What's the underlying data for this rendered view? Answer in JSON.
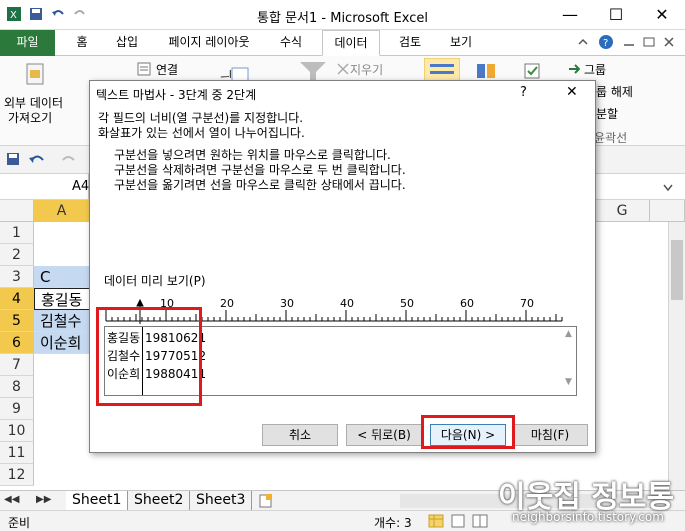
{
  "window": {
    "title": "통합 문서1 - Microsoft Excel",
    "min": "—",
    "max": "☐",
    "close": "✕"
  },
  "tabs": {
    "file": "파일",
    "items": [
      "홈",
      "삽입",
      "페이지 레이아웃",
      "수식",
      "데이터",
      "검토",
      "보기"
    ],
    "active": "데이터"
  },
  "ribbon": {
    "get_external_line1": "외부 데이터",
    "get_external_line2": "가져오기",
    "connections": "연결",
    "clear": "지우기",
    "group": "그룹",
    "ungroup": "룹 해제",
    "subtotal": "분할",
    "outline": "윤곽선"
  },
  "namebox": {
    "value": "A4"
  },
  "grid": {
    "col_letter_a": "A",
    "col_letter_g": "G",
    "rows": [
      "1",
      "2",
      "3",
      "4",
      "5",
      "6",
      "7",
      "8",
      "9",
      "10",
      "11",
      "12"
    ],
    "selected_rows": [
      "4",
      "5",
      "6"
    ],
    "row3_partial": "C",
    "names": [
      "홍길동",
      "김철수",
      "이순희"
    ]
  },
  "sheets": {
    "tabs": [
      "Sheet1",
      "Sheet2",
      "Sheet3"
    ],
    "active": "Sheet1"
  },
  "status": {
    "ready": "준비",
    "count": "개수: 3"
  },
  "dialog": {
    "title": "텍스트 마법사 - 3단계 중 2단계",
    "help": "?",
    "close": "✕",
    "line1": "각 필드의 너비(열 구분선)를 지정합니다.",
    "line2": "화살표가 있는 선에서 열이 나누어집니다.",
    "instr1": "구분선을 넣으려면 원하는 위치를 마우스로 클릭합니다.",
    "instr2": "구분선을 삭제하려면 구분선을 마우스로 두 번 클릭합니다.",
    "instr3": "구분선을 옮기려면 선을 마우스로 클릭한 상태에서 끕니다.",
    "preview_label": "데이터 미리 보기(P)",
    "ruler_labels": [
      "10",
      "20",
      "30",
      "40",
      "50",
      "60",
      "70"
    ],
    "preview_rows": [
      {
        "name": "홍길동",
        "date": "19810621"
      },
      {
        "name": "김철수",
        "date": "19770512"
      },
      {
        "name": "이순희",
        "date": "19880411"
      }
    ],
    "buttons": {
      "cancel": "취소",
      "back": "< 뒤로(B)",
      "next": "다음(N) >",
      "finish": "마침(F)"
    },
    "highlight_color": "#e0191d"
  },
  "watermark": {
    "title": "이웃집 정보통",
    "url": "neighborsinfo.tistory.com"
  }
}
